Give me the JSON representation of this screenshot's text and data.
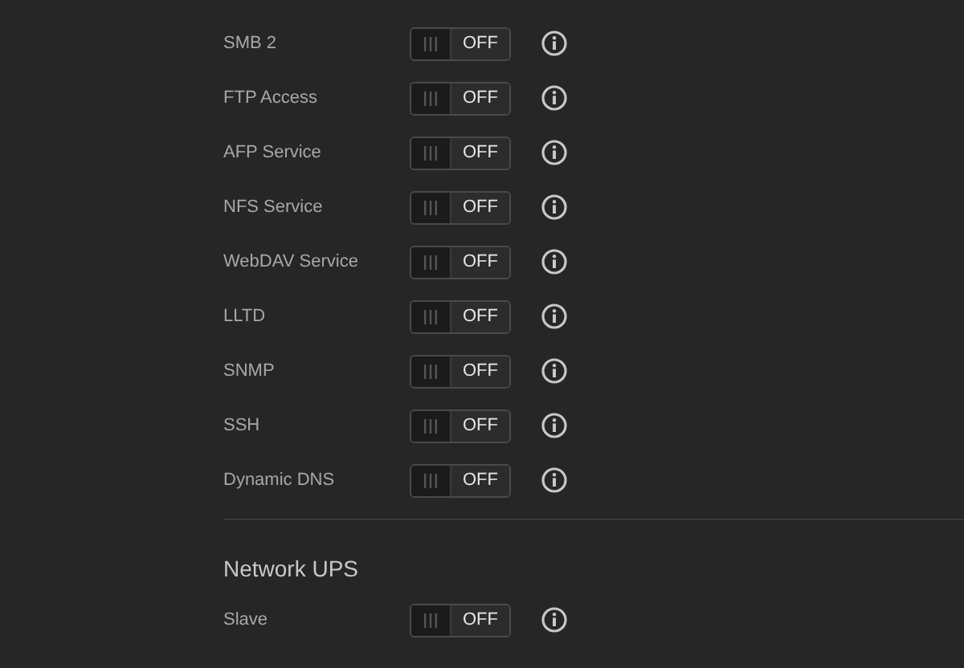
{
  "services": [
    {
      "label": "SMB 2",
      "on": false,
      "state_text": "OFF"
    },
    {
      "label": "FTP Access",
      "on": false,
      "state_text": "OFF"
    },
    {
      "label": "AFP Service",
      "on": false,
      "state_text": "OFF"
    },
    {
      "label": "NFS Service",
      "on": false,
      "state_text": "OFF"
    },
    {
      "label": "WebDAV Service",
      "on": false,
      "state_text": "OFF"
    },
    {
      "label": "LLTD",
      "on": false,
      "state_text": "OFF"
    },
    {
      "label": "SNMP",
      "on": false,
      "state_text": "OFF"
    },
    {
      "label": "SSH",
      "on": false,
      "state_text": "OFF"
    },
    {
      "label": "Dynamic DNS",
      "on": false,
      "state_text": "OFF"
    }
  ],
  "network_ups": {
    "heading": "Network UPS",
    "items": [
      {
        "label": "Slave",
        "on": false,
        "state_text": "OFF"
      }
    ]
  }
}
